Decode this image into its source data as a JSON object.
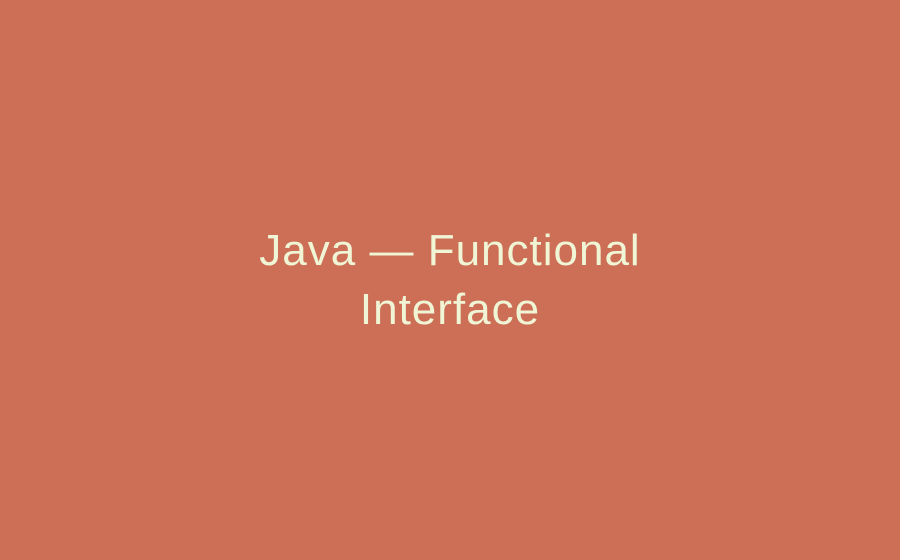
{
  "title": "Java — Functional Interface",
  "colors": {
    "background": "#cc6f56",
    "text": "#f0f5d6"
  }
}
